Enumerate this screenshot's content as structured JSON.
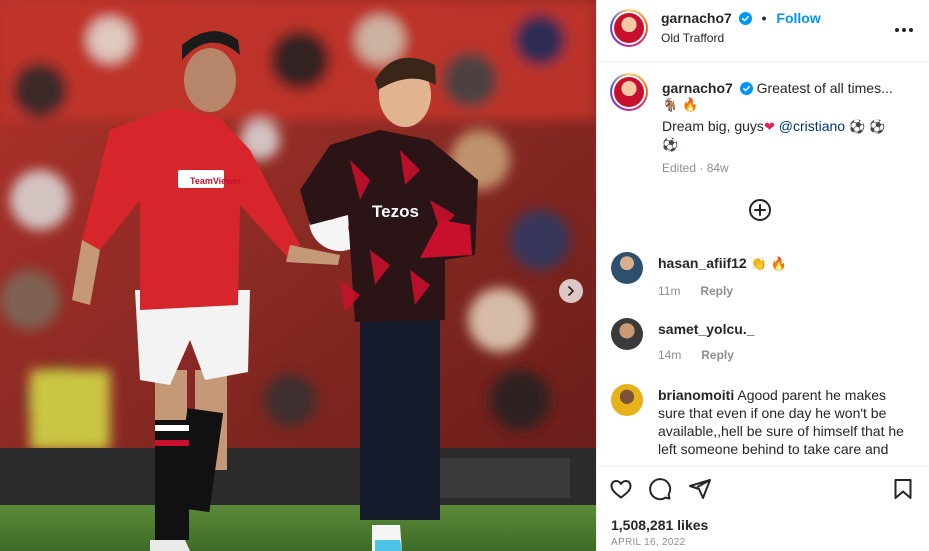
{
  "post": {
    "author": "garnacho7",
    "location": "Old Trafford",
    "follow_label": "Follow",
    "separator": "•"
  },
  "caption": {
    "author": "garnacho7",
    "line1": "Greatest of all times...",
    "line1_emojis": "🐐 🔥",
    "line2": "Dream big, guys",
    "line2_heart": "❤",
    "mention": "@cristiano",
    "balls": "⚽ ⚽",
    "ball_last": "⚽",
    "edited": "Edited",
    "age": "84w"
  },
  "comments": [
    {
      "user": "hasan_afiif12",
      "text": "👏 🔥",
      "age": "11m",
      "reply": "Reply"
    },
    {
      "user": "samet_yolcu._",
      "text": "",
      "age": "14m",
      "reply": "Reply"
    },
    {
      "user": "brianomoiti",
      "text_lines": [
        "Agood parent he makes",
        "sure that even if one day he won't be",
        "available,,hell be sure of himself that he",
        "left someone behind to take care and"
      ]
    }
  ],
  "jersey": {
    "sponsor_left": "TeamViewer",
    "sponsor_right": "Tezos"
  },
  "engagement": {
    "likes": "1,508,281 likes",
    "date": "APRIL 16, 2022"
  },
  "icons": {
    "verified": "verified-badge-icon",
    "more": "more-options-icon",
    "like": "heart-icon",
    "comment": "comment-icon",
    "share": "send-icon",
    "save": "bookmark-icon",
    "load_more": "plus-circle-icon",
    "next": "chevron-right-icon"
  },
  "colors": {
    "link_blue": "#0095f6",
    "mention_blue": "#00376b",
    "verified_blue": "#0095f6",
    "muted": "#8e8e8e",
    "united_red": "#c8102e"
  }
}
